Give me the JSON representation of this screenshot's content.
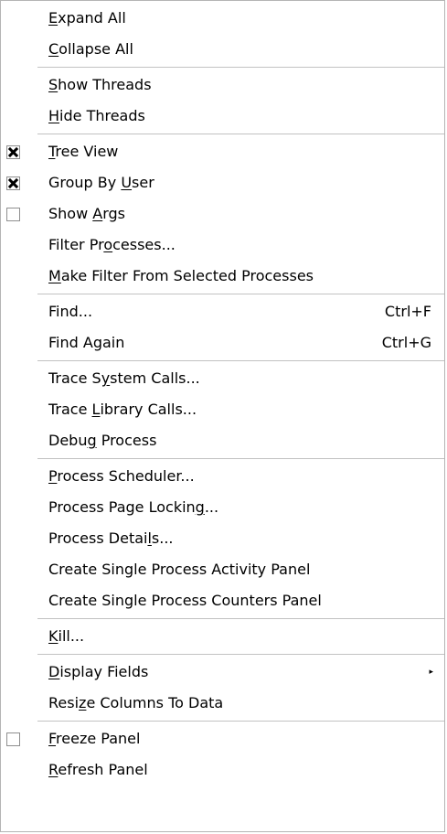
{
  "menu": {
    "groups": [
      {
        "items": [
          {
            "label": "Expand All",
            "mnemonic": 0
          },
          {
            "label": "Collapse All",
            "mnemonic": 0
          }
        ]
      },
      {
        "items": [
          {
            "label": "Show Threads",
            "mnemonic": 0
          },
          {
            "label": "Hide Threads",
            "mnemonic": 0
          }
        ]
      },
      {
        "items": [
          {
            "label": "Tree View",
            "mnemonic": 0,
            "checkbox": true,
            "checked": true
          },
          {
            "label": "Group By User",
            "mnemonic": 9,
            "checkbox": true,
            "checked": true
          },
          {
            "label": "Show Args",
            "mnemonic": 5,
            "checkbox": true,
            "checked": false
          },
          {
            "label": "Filter Processes...",
            "mnemonic": 9
          },
          {
            "label": "Make Filter From Selected Processes",
            "mnemonic": 0
          }
        ]
      },
      {
        "items": [
          {
            "label": "Find...",
            "shortcut": "Ctrl+F"
          },
          {
            "label": "Find Again",
            "shortcut": "Ctrl+G"
          }
        ]
      },
      {
        "items": [
          {
            "label": "Trace System Calls...",
            "mnemonic": 7
          },
          {
            "label": "Trace Library Calls...",
            "mnemonic": 6
          },
          {
            "label": "Debug Process",
            "mnemonic": 4
          }
        ]
      },
      {
        "items": [
          {
            "label": "Process Scheduler...",
            "mnemonic": 0
          },
          {
            "label": "Process Page Locking...",
            "mnemonic": 19
          },
          {
            "label": "Process Details...",
            "mnemonic": 13
          },
          {
            "label": "Create Single Process Activity Panel"
          },
          {
            "label": "Create Single Process Counters Panel"
          }
        ]
      },
      {
        "items": [
          {
            "label": "Kill...",
            "mnemonic": 0
          }
        ]
      },
      {
        "items": [
          {
            "label": "Display Fields",
            "mnemonic": 0,
            "submenu": true,
            "submenu_arrow": "▸"
          },
          {
            "label": "Resize Columns To Data",
            "mnemonic": 4
          }
        ]
      },
      {
        "items": [
          {
            "label": "Freeze Panel",
            "mnemonic": 0,
            "checkbox": true,
            "checked": false
          },
          {
            "label": "Refresh Panel",
            "mnemonic": 0
          }
        ]
      }
    ]
  }
}
